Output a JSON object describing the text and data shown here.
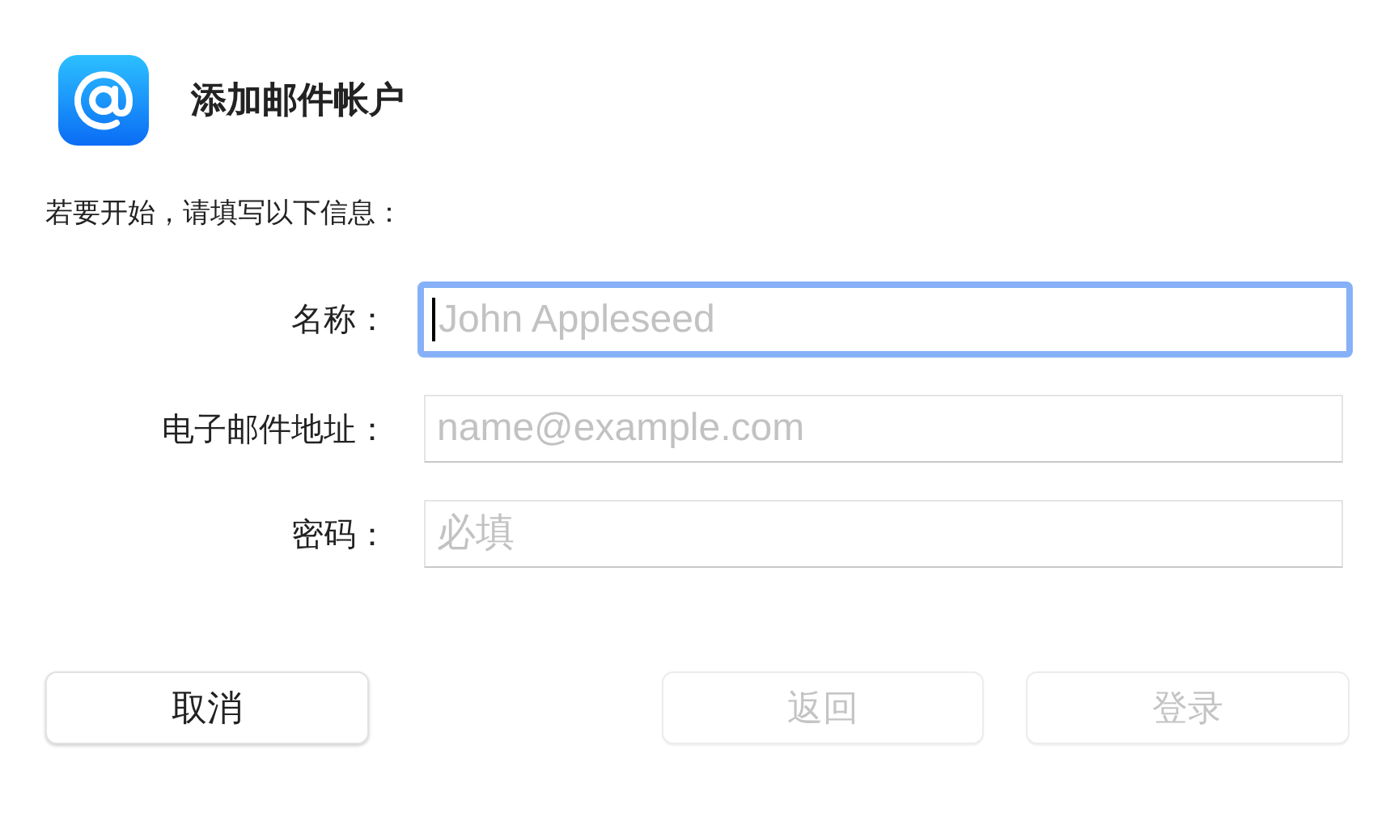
{
  "header": {
    "title": "添加邮件帐户"
  },
  "intro": "若要开始，请填写以下信息：",
  "fields": [
    {
      "label": "名称：",
      "placeholder": "John Appleseed",
      "focused": true
    },
    {
      "label": "电子邮件地址：",
      "placeholder": "name@example.com",
      "focused": false
    },
    {
      "label": "密码：",
      "placeholder": "必填",
      "focused": false
    }
  ],
  "buttons": [
    {
      "label": "取消",
      "disabled": false
    },
    {
      "label": "返回",
      "disabled": true
    },
    {
      "label": "登录",
      "disabled": true
    }
  ]
}
